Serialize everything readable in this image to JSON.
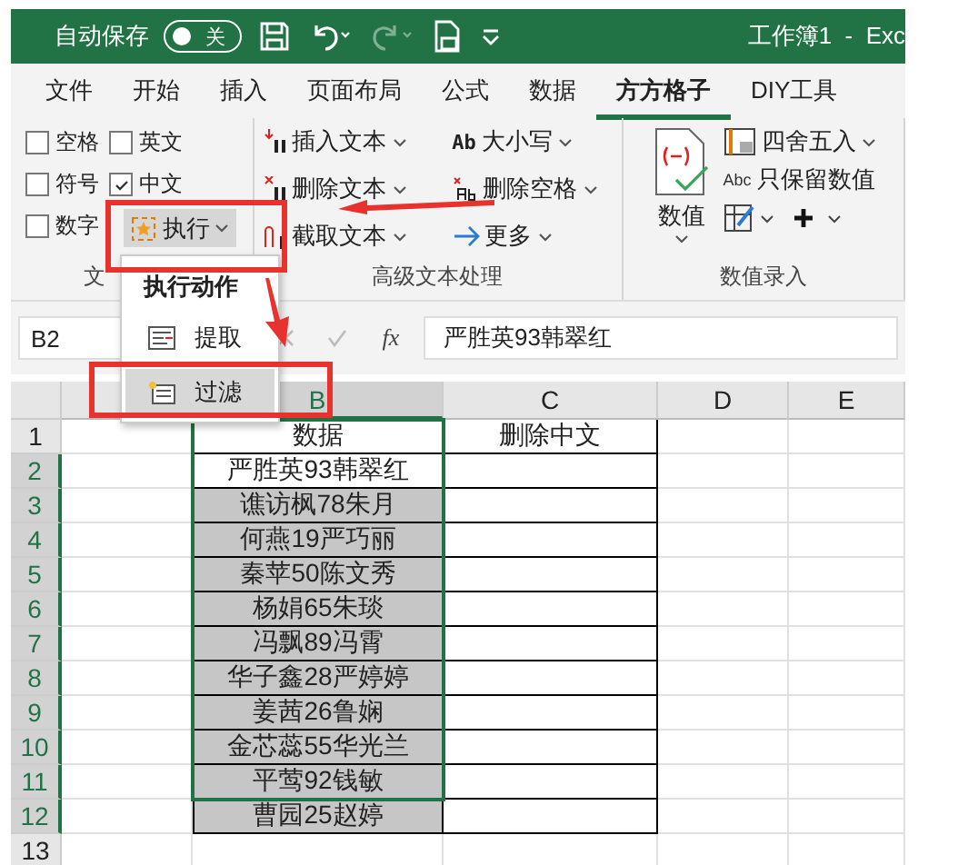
{
  "title_bar": {
    "autosave_label": "自动保存",
    "autosave_toggle": {
      "label": "关",
      "on": false
    },
    "title": "工作簿1  -  Exc"
  },
  "tabs": [
    {
      "label": "文件",
      "selected": false
    },
    {
      "label": "开始",
      "selected": false
    },
    {
      "label": "插入",
      "selected": false
    },
    {
      "label": "页面布局",
      "selected": false
    },
    {
      "label": "公式",
      "selected": false
    },
    {
      "label": "数据",
      "selected": false
    },
    {
      "label": "方方格子",
      "selected": true
    },
    {
      "label": "DIY工具",
      "selected": false
    }
  ],
  "text_group": {
    "label": "文",
    "checkboxes": [
      {
        "label": "空格",
        "checked": false
      },
      {
        "label": "英文",
        "checked": false
      },
      {
        "label": "符号",
        "checked": false
      },
      {
        "label": "中文",
        "checked": true
      },
      {
        "label": "数字",
        "checked": false
      }
    ],
    "run_button": {
      "label": "执行",
      "pressed": true
    }
  },
  "advanced_group": {
    "label": "高级文本处理",
    "buttons": [
      {
        "label": "插入文本",
        "kind": "insert"
      },
      {
        "label": "大小写",
        "kind": "case",
        "icon_text": "Ab"
      },
      {
        "label": "删除文本",
        "kind": "delete"
      },
      {
        "label": "删除空格",
        "kind": "space"
      },
      {
        "label": "截取文本",
        "kind": "cut"
      },
      {
        "label": "更多",
        "kind": "more"
      }
    ]
  },
  "number_group": {
    "label": "数值录入",
    "big_button": "数值",
    "buttons": [
      {
        "label": "四舍五入",
        "kind": "round"
      },
      {
        "label": "只保留数值",
        "kind": "keep",
        "icon_text": "Abc"
      }
    ]
  },
  "dropdown_menu": {
    "heading": "执行动作",
    "items": [
      {
        "label": "提取",
        "selected": false
      },
      {
        "label": "过滤",
        "selected": true
      }
    ]
  },
  "formula_bar": {
    "name_box": "B2",
    "fx": "fx",
    "value": "严胜英93韩翠红"
  },
  "sheet": {
    "columns": [
      {
        "label": "B",
        "selected": true
      },
      {
        "label": "C",
        "selected": false
      },
      {
        "label": "D",
        "selected": false
      },
      {
        "label": "E",
        "selected": false
      }
    ],
    "rows": [
      {
        "number": "1",
        "selected": false,
        "b": "数据",
        "c": "删除中文"
      },
      {
        "number": "2",
        "selected": true,
        "active": true,
        "b": "严胜英93韩翠红"
      },
      {
        "number": "3",
        "selected": true,
        "active": false,
        "b": "谯访枫78朱月"
      },
      {
        "number": "4",
        "selected": true,
        "active": false,
        "b": "何燕19严巧丽"
      },
      {
        "number": "5",
        "selected": true,
        "active": false,
        "b": "秦苹50陈文秀"
      },
      {
        "number": "6",
        "selected": true,
        "active": false,
        "b": "杨娟65朱琰"
      },
      {
        "number": "7",
        "selected": true,
        "active": false,
        "b": "冯飘89冯霄"
      },
      {
        "number": "8",
        "selected": true,
        "active": false,
        "b": "华子鑫28严婷婷"
      },
      {
        "number": "9",
        "selected": true,
        "active": false,
        "b": "姜茜26鲁娴"
      },
      {
        "number": "10",
        "selected": true,
        "active": false,
        "b": "金芯蕊55华光兰"
      },
      {
        "number": "11",
        "selected": true,
        "active": false,
        "b": "平莺92钱敏"
      },
      {
        "number": "12",
        "selected": true,
        "active": false,
        "b": "曹园25赵婷"
      },
      {
        "number": "13",
        "selected": false
      }
    ]
  }
}
